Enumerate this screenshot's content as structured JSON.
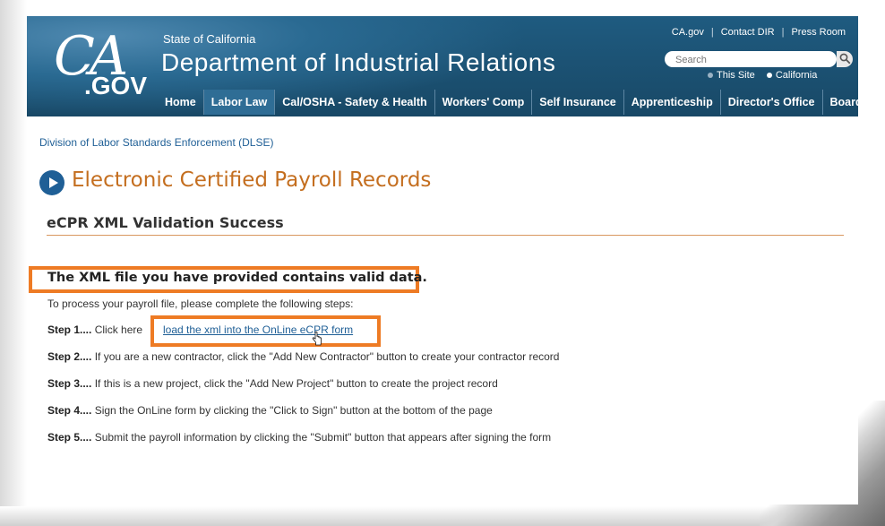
{
  "header": {
    "state": "State of California",
    "department": "Department of Industrial Relations",
    "logo_ca": "CA",
    "logo_gov": ".GOV",
    "toplinks": [
      "CA.gov",
      "Contact DIR",
      "Press Room"
    ],
    "search_placeholder": "Search",
    "search_scope": [
      "This Site",
      "California"
    ],
    "nav": [
      "Home",
      "Labor Law",
      "Cal/OSHA - Safety & Health",
      "Workers' Comp",
      "Self Insurance",
      "Apprenticeship",
      "Director's Office",
      "Boards"
    ]
  },
  "breadcrumb": "Division of Labor Standards Enforcement (DLSE)",
  "title": "Electronic Certified Payroll Records",
  "subtitle": "eCPR XML Validation Success",
  "valid_message": "The XML file you have provided contains valid data.",
  "instructions": "To process your payroll file, please complete the following steps:",
  "steps": [
    {
      "label": "Step 1....",
      "text": "Click here",
      "link": "load the xml into the OnLine eCPR form"
    },
    {
      "label": "Step 2....",
      "text": "If you are a new contractor, click the \"Add New Contractor\" button to create your contractor record"
    },
    {
      "label": "Step 3....",
      "text": "If this is a new project, click the \"Add New Project\" button to create the project record"
    },
    {
      "label": "Step 4....",
      "text": "Sign the OnLine form by clicking the \"Click to Sign\" button at the bottom of the page"
    },
    {
      "label": "Step 5....",
      "text": "Submit the payroll information by clicking the \"Submit\" button that appears after signing the form"
    }
  ],
  "colors": {
    "header_bg": "#1c4a6a",
    "accent_orange": "#ee7b24",
    "title_orange": "#c46e1f",
    "link_blue": "#1f5f96"
  }
}
